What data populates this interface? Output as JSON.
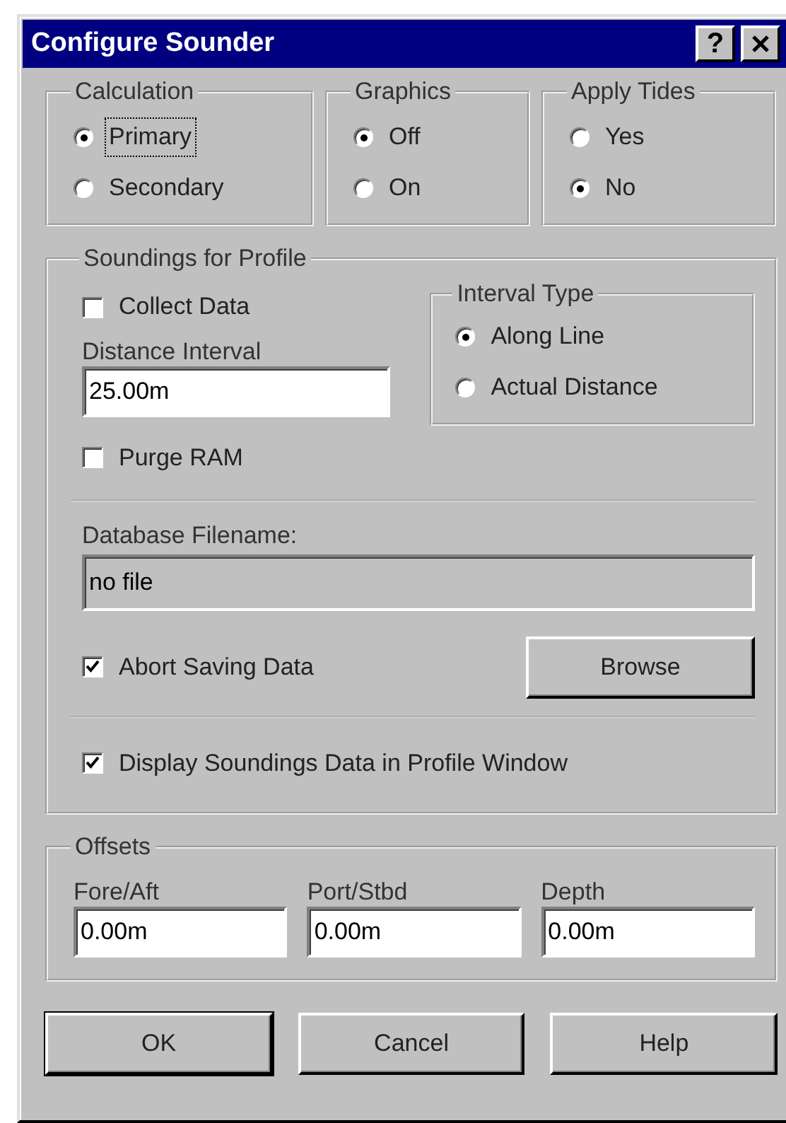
{
  "window": {
    "title": "Configure Sounder",
    "help_button": "?"
  },
  "top_groups": [
    {
      "title": "Calculation",
      "options": [
        {
          "label": "Primary",
          "selected": true,
          "focused": true
        },
        {
          "label": "Secondary",
          "selected": false,
          "focused": false
        }
      ]
    },
    {
      "title": "Graphics",
      "options": [
        {
          "label": "Off",
          "selected": true,
          "focused": false
        },
        {
          "label": "On",
          "selected": false,
          "focused": false
        }
      ]
    },
    {
      "title": "Apply Tides",
      "options": [
        {
          "label": "Yes",
          "selected": false,
          "focused": false
        },
        {
          "label": "No",
          "selected": true,
          "focused": false
        }
      ]
    }
  ],
  "soundings": {
    "title": "Soundings for Profile",
    "collect_data": {
      "label": "Collect Data",
      "checked": false
    },
    "distance_interval": {
      "label": "Distance Interval",
      "value": "25.00m"
    },
    "interval_type": {
      "title": "Interval Type",
      "options": [
        {
          "label": "Along Line",
          "selected": true,
          "focused": false
        },
        {
          "label": "Actual Distance",
          "selected": false,
          "focused": false
        }
      ]
    },
    "purge_ram": {
      "label": "Purge RAM",
      "checked": false
    },
    "database_filename": {
      "label": "Database Filename:",
      "value": "no file",
      "read_only": true
    },
    "abort_saving": {
      "label": "Abort Saving Data",
      "checked": true
    },
    "browse_button": "Browse",
    "display_soundings": {
      "label": "Display Soundings Data in Profile Window",
      "checked": true
    }
  },
  "offsets": {
    "title": "Offsets",
    "fields": [
      {
        "label": "Fore/Aft",
        "value": "0.00m"
      },
      {
        "label": "Port/Stbd",
        "value": "0.00m"
      },
      {
        "label": "Depth",
        "value": "0.00m"
      }
    ]
  },
  "buttons": [
    {
      "label": "OK",
      "default": true
    },
    {
      "label": "Cancel",
      "default": false
    },
    {
      "label": "Help",
      "default": false
    }
  ]
}
